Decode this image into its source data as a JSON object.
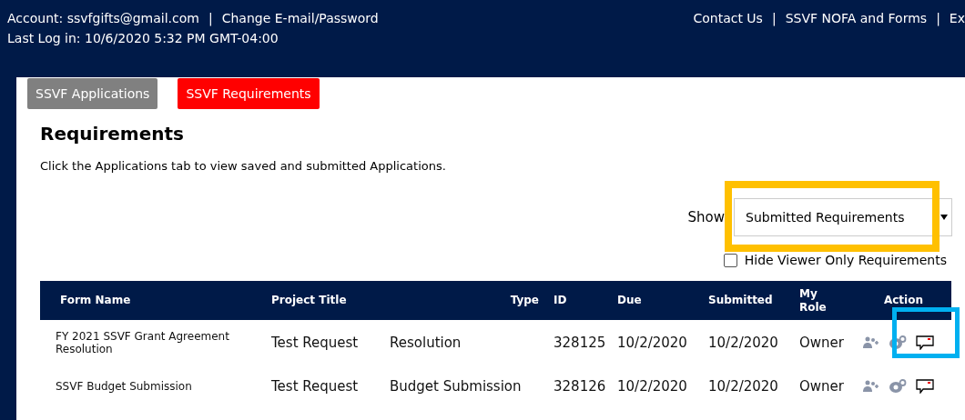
{
  "header": {
    "account": "Account: ssvfgifts@gmail.com",
    "account_links": [
      {
        "separator": "|",
        "label": "Change E-mail/Password"
      }
    ],
    "last_login": "Last Log in: 10/6/2020 5:32 PM GMT-04:00",
    "links": [
      {
        "label": "Contact Us"
      },
      {
        "separator": "|",
        "label": "SSVF NOFA and Forms"
      },
      {
        "separator": "|",
        "label": "Ex"
      }
    ]
  },
  "tabs": [
    {
      "label": "SSVF Applications",
      "selected": false
    },
    {
      "label": "SSVF Requirements",
      "selected": true
    }
  ],
  "title": "Requirements",
  "intro": "Click the Applications tab to view saved and submitted Applications.",
  "filter": {
    "label": "Show",
    "value": "Submitted Requirements",
    "highlighted": true
  },
  "hide_viewer": {
    "label": "Hide Viewer Only Requirements",
    "checked": false
  },
  "table": {
    "columns": [
      "Form Name",
      "Project Title",
      "Type",
      "ID",
      "Due",
      "Submitted",
      "My Role",
      "Action"
    ],
    "rows": [
      {
        "cells": [
          "FY 2021 SSVF Grant Agreement Resolution",
          "Test Request",
          "Resolution",
          "328125",
          "10/2/2020",
          "10/2/2020",
          "Owner"
        ],
        "actions_highlighted": true
      },
      {
        "cells": [
          "SSVF Budget Submission",
          "Test Request",
          "Budget Submission",
          "328126",
          "10/2/2020",
          "10/2/2020",
          "Owner"
        ],
        "actions_highlighted": false
      }
    ]
  }
}
